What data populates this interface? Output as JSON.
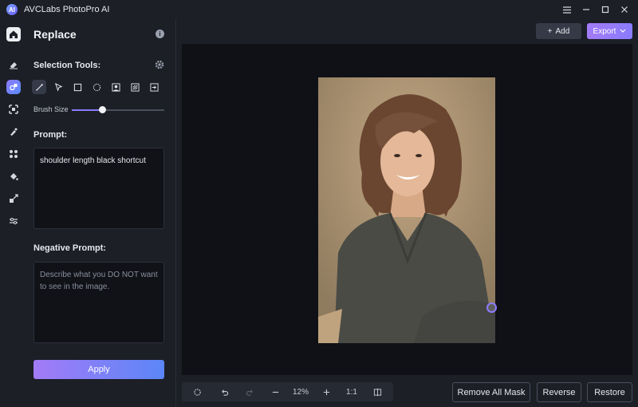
{
  "app": {
    "title": "AVCLabs PhotoPro AI",
    "logo_text": "AI"
  },
  "window_controls": [
    "menu-icon",
    "minimize-icon",
    "maximize-icon",
    "close-icon"
  ],
  "rail_icons": [
    "home-icon",
    "eraser-icon",
    "replace-icon",
    "upscale-icon",
    "colorize-icon",
    "face-icon",
    "fill-icon",
    "expand-icon",
    "adjust-icon"
  ],
  "panel": {
    "title": "Replace",
    "selection_tools_label": "Selection Tools:",
    "tools": [
      "brush-tool",
      "lasso-tool",
      "rect-tool",
      "ellipse-tool",
      "portrait-tool",
      "object-tool",
      "invert-tool"
    ],
    "brush_size_label": "Brush Size",
    "brush_size_value": 0.33,
    "prompt_label": "Prompt:",
    "prompt_value": "shoulder length black shortcut",
    "negative_prompt_label": "Negative Prompt:",
    "negative_prompt_placeholder": "Describe what you DO NOT want to see in the image.",
    "apply_label": "Apply"
  },
  "workspace": {
    "add_label": "Add",
    "export_label": "Export",
    "zoom_label": "12%",
    "ratio_label": "1:1",
    "remove_all_mask_label": "Remove All Mask",
    "reverse_label": "Reverse",
    "restore_label": "Restore"
  },
  "colors": {
    "accent": "#8a7bff",
    "background": "#1c1f26",
    "canvas": "#0f1116"
  }
}
